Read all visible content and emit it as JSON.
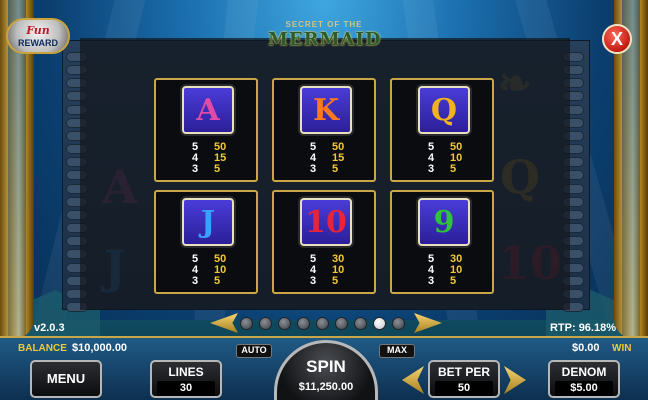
{
  "header": {
    "logo_top": "SECRET OF THE",
    "logo_main": "MERMAID",
    "rewards_logo_top": "Fun",
    "rewards_logo_bottom": "REWARD",
    "close_label": "X"
  },
  "paytable": [
    {
      "symbol": "A",
      "color": "#e04aa8",
      "payouts": [
        {
          "count": "5",
          "amount": "50"
        },
        {
          "count": "4",
          "amount": "15"
        },
        {
          "count": "3",
          "amount": "5"
        }
      ]
    },
    {
      "symbol": "K",
      "color": "#ff7a1c",
      "payouts": [
        {
          "count": "5",
          "amount": "50"
        },
        {
          "count": "4",
          "amount": "15"
        },
        {
          "count": "3",
          "amount": "5"
        }
      ]
    },
    {
      "symbol": "Q",
      "color": "#f2b21c",
      "payouts": [
        {
          "count": "5",
          "amount": "50"
        },
        {
          "count": "4",
          "amount": "10"
        },
        {
          "count": "3",
          "amount": "5"
        }
      ]
    },
    {
      "symbol": "J",
      "color": "#3aa0ff",
      "payouts": [
        {
          "count": "5",
          "amount": "50"
        },
        {
          "count": "4",
          "amount": "10"
        },
        {
          "count": "3",
          "amount": "5"
        }
      ]
    },
    {
      "symbol": "10",
      "color": "#e8243a",
      "payouts": [
        {
          "count": "5",
          "amount": "30"
        },
        {
          "count": "4",
          "amount": "10"
        },
        {
          "count": "3",
          "amount": "5"
        }
      ]
    },
    {
      "symbol": "9",
      "color": "#2ec43a",
      "payouts": [
        {
          "count": "5",
          "amount": "30"
        },
        {
          "count": "4",
          "amount": "10"
        },
        {
          "count": "3",
          "amount": "5"
        }
      ]
    }
  ],
  "pager": {
    "total_pages": 9,
    "active_page": 8
  },
  "footer": {
    "version": "v2.0.3",
    "rtp": "RTP: 96.18%",
    "balance_label": "BALANCE",
    "balance_value": "$10,000.00",
    "win_value": "$0.00",
    "win_label": "WIN",
    "menu_label": "MENU",
    "lines_label": "LINES",
    "lines_value": "30",
    "auto_label": "AUTO",
    "max_label": "MAX",
    "spin_label": "SPIN",
    "spin_value": "$11,250.00",
    "betper_label": "BET PER",
    "betper_value": "50",
    "denom_label": "DENOM",
    "denom_value": "$5.00"
  },
  "colors": {
    "frame_gold": "#c9a646",
    "accent_yellow": "#f0c838",
    "panel_dark": "#0b0c0f",
    "close_red": "#c21b12"
  }
}
